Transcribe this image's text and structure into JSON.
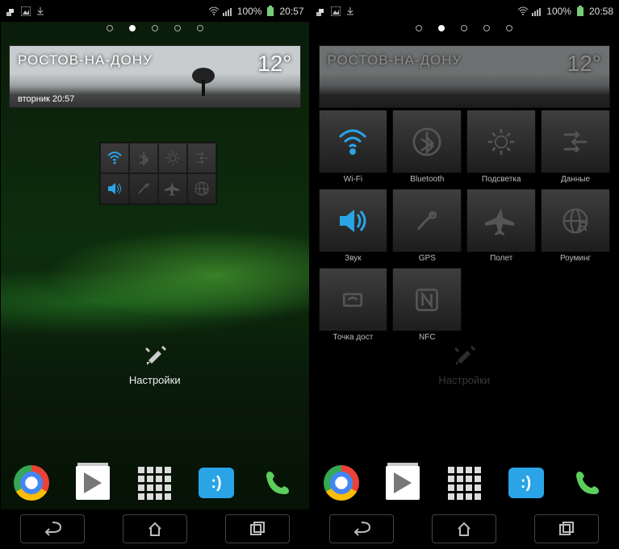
{
  "status_left": {
    "battery": "100%",
    "time": "20:57"
  },
  "status_right": {
    "battery": "100%",
    "time": "20:58"
  },
  "weather": {
    "city": "РОСТОВ-НА-ДОНУ",
    "temp": "12°",
    "dayline": "вторник 20:57"
  },
  "settings_label": "Настройки",
  "mini_widget": {
    "row1": [
      "wifi",
      "bluetooth",
      "brightness",
      "data"
    ],
    "row2": [
      "sound",
      "gps",
      "airplane",
      "roaming"
    ],
    "active": [
      "wifi",
      "sound"
    ]
  },
  "quick_tiles": [
    {
      "key": "wifi",
      "label": "Wi-Fi",
      "active": true
    },
    {
      "key": "bluetooth",
      "label": "Bluetooth",
      "active": false
    },
    {
      "key": "brightness",
      "label": "Подсветка",
      "active": false
    },
    {
      "key": "data",
      "label": "Данные",
      "active": false
    },
    {
      "key": "sound",
      "label": "Звук",
      "active": true
    },
    {
      "key": "gps",
      "label": "GPS",
      "active": false
    },
    {
      "key": "airplane",
      "label": "Полет",
      "active": false,
      "highlight": true
    },
    {
      "key": "roaming",
      "label": "Роуминг",
      "active": false
    },
    {
      "key": "hotspot",
      "label": "Точка дост",
      "active": false
    },
    {
      "key": "nfc",
      "label": "NFC",
      "active": false
    }
  ],
  "dock_apps": [
    "chrome",
    "play",
    "allapps",
    "sms",
    "phone"
  ],
  "page_dots": {
    "count": 5,
    "active": 1
  }
}
